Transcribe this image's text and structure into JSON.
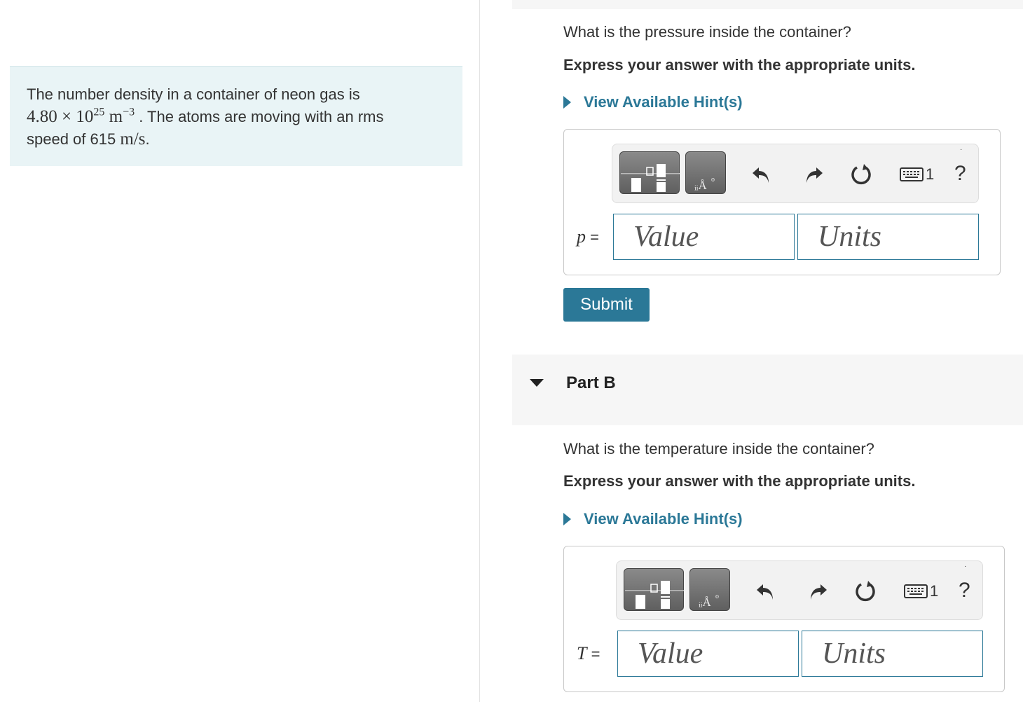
{
  "intro": {
    "text_1": "The number density in a container of neon gas is",
    "number_mantissa": "4.80",
    "times": "×",
    "base": "10",
    "exponent": "25",
    "unit": "m",
    "unit_exponent": "−3",
    "text_2": ". The atoms are moving with an rms",
    "text_3": "speed of 615",
    "speed_unit": "m/s",
    "text_4": "."
  },
  "part_a": {
    "question": "What is the pressure inside the container?",
    "instruction": "Express your answer with the appropriate units.",
    "hint_label": "View Available Hint(s)",
    "variable": "p",
    "equals": "=",
    "value_placeholder": "Value",
    "units_placeholder": "Units",
    "keyboard_count": "1",
    "help_label": "?",
    "submit_label": "Submit"
  },
  "part_b": {
    "title": "Part B",
    "question": "What is the temperature inside the container?",
    "instruction": "Express your answer with the appropriate units.",
    "hint_label": "View Available Hint(s)",
    "variable": "T",
    "equals": "=",
    "value_placeholder": "Value",
    "units_placeholder": "Units",
    "keyboard_count": "1",
    "help_label": "?"
  },
  "toolbar_icons": [
    "templates-icon",
    "units-icon",
    "undo-icon",
    "redo-icon",
    "reset-icon",
    "keyboard-icon",
    "help-icon"
  ],
  "colors": {
    "accent": "#2b7897",
    "intro_bg": "#e9f4f6",
    "band_bg": "#f6f6f6"
  }
}
